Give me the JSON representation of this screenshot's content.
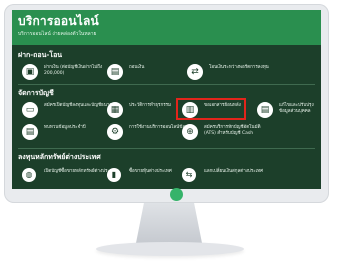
{
  "app": {
    "title": "บริการออนไลน์",
    "subtitle": "บริการออนไลน์ ง่ายคล่องตัวในหลาย"
  },
  "sections": {
    "deposit_withdraw_transfer": {
      "title": "ฝาก-ถอน-โอน",
      "items": [
        {
          "label": "ฝากเงิน (ต่อบัญชีเงินฝากไม่ถึง 200,000)",
          "icon": "deposit-icon"
        },
        {
          "label": "ถอนเงิน",
          "icon": "withdraw-icon"
        },
        {
          "label": "โอนเงินระหว่างพอร์ตการลงทุน",
          "icon": "transfer-icon"
        }
      ]
    },
    "account_management": {
      "title": "จัดการบัญชี",
      "items": [
        {
          "label": "สมัครเปิดบัญชีลงทุนและบัญชีธนาคาร",
          "icon": "card-icon"
        },
        {
          "label": "ประวัติการทำธุรกรรม",
          "icon": "history-icon"
        },
        {
          "label": "ขอเอกสารย้อนหลัง",
          "icon": "document-icon"
        },
        {
          "label": "แก้ไขและปรับปรุงข้อมูลส่วนบุคคล",
          "icon": "profile-icon"
        },
        {
          "label": "ทบทวนข้อมูลประจำปี",
          "icon": "review-icon"
        },
        {
          "label": "การใช้งานบริการออนไลน์ข้อมูล",
          "icon": "settings-icon"
        },
        {
          "label": "สมัครบริการหักบัญชีอัตโนมัติ (ATS) สำหรับบัญชี Cash",
          "icon": "ats-icon"
        }
      ]
    },
    "foreign_securities": {
      "title": "ลงทุนหลักทรัพย์ต่างประเทศ",
      "items": [
        {
          "label": "เปิดบัญชีซื้อขายหลักทรัพย์ต่างประเทศ",
          "icon": "globe-icon"
        },
        {
          "label": "ซื้อขายหุ้นต่างประเทศ",
          "icon": "chart-icon"
        },
        {
          "label": "แลกเปลี่ยนเงินสกุลต่างประเทศ",
          "icon": "exchange-icon"
        }
      ]
    }
  },
  "colors": {
    "brand_green": "#2a8f4f",
    "screen_dark": "#1c3f2a",
    "highlight_red": "#e1251b"
  }
}
